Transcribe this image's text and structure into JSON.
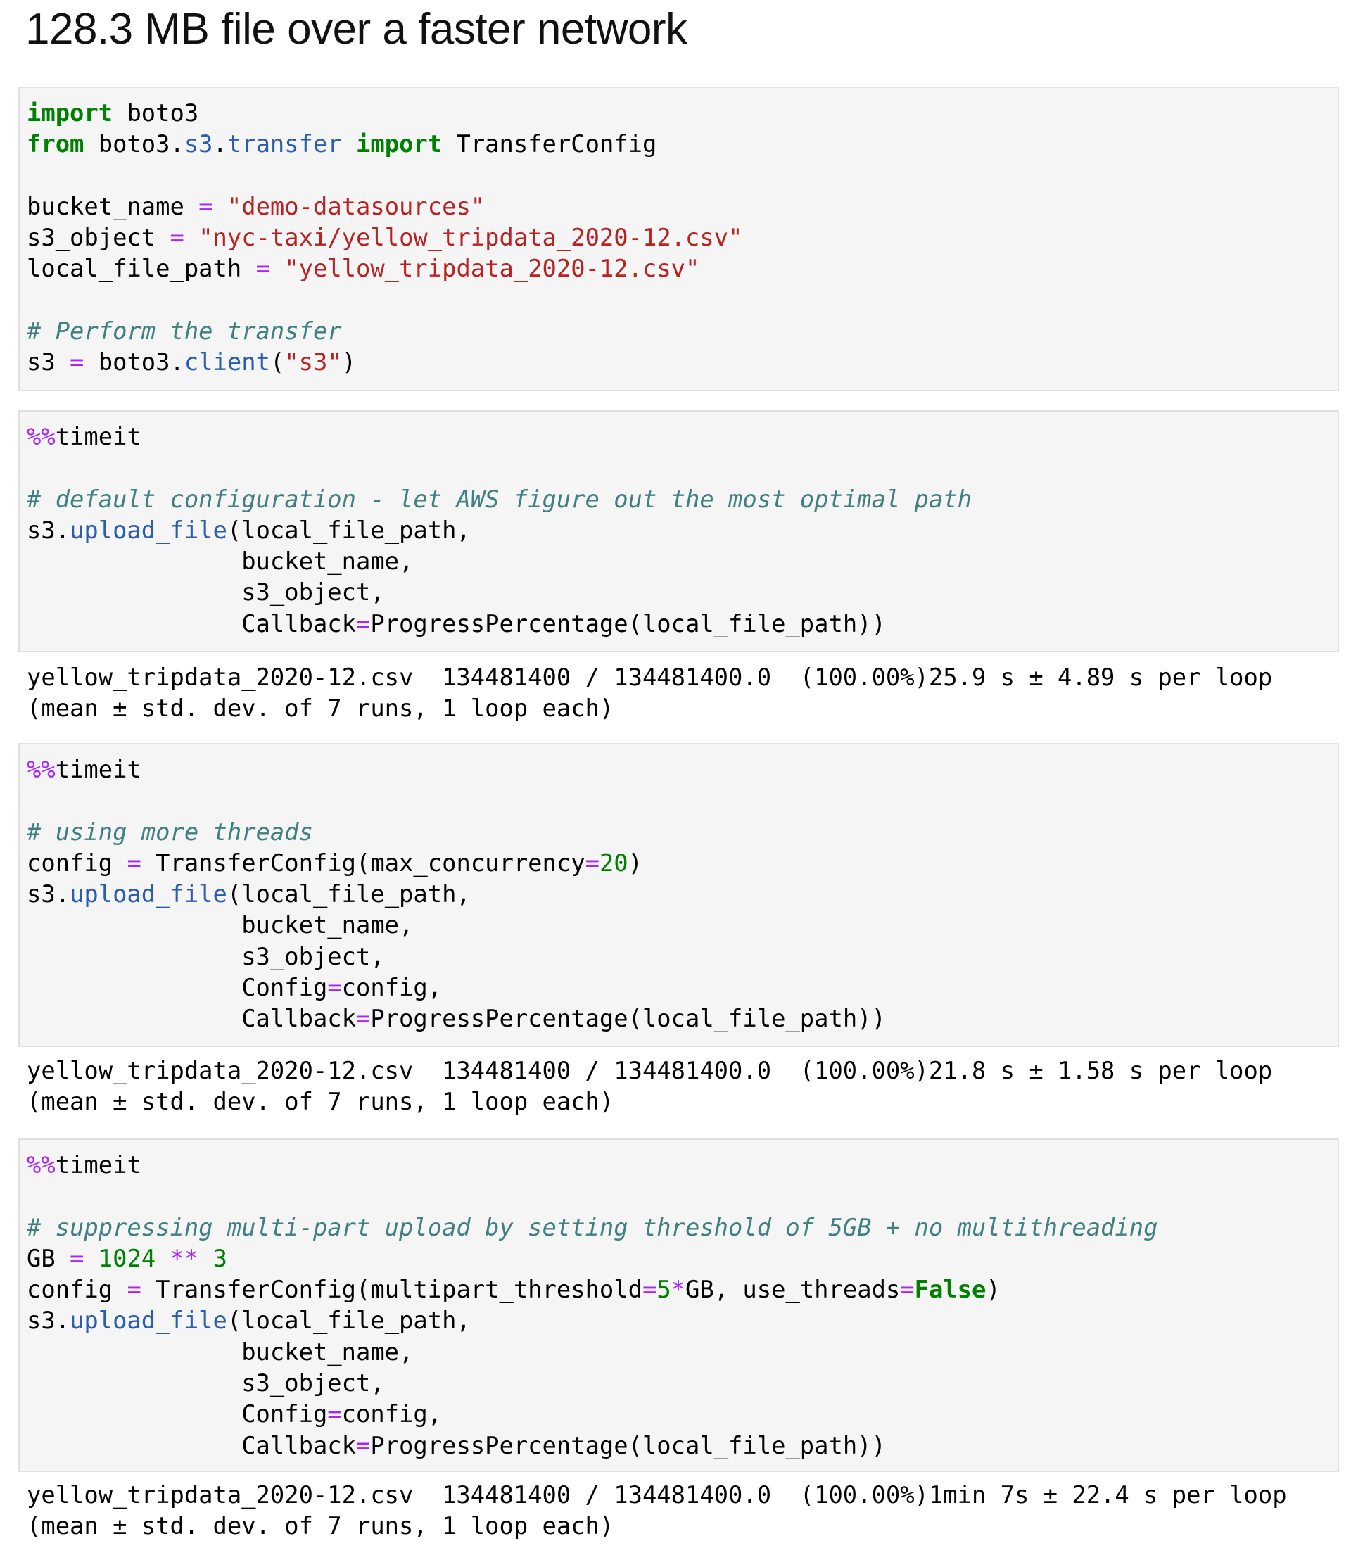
{
  "page": {
    "title": "128.3 MB file over a faster network"
  },
  "theme": {
    "keyword": "#008000",
    "operator": "#aa22ff",
    "number": "#008000",
    "string": "#ba2121",
    "comment": "#408080",
    "property": "#2a5db0",
    "cell_background": "#f5f5f5",
    "cell_border": "#e0e0e0"
  },
  "cells": [
    {
      "prompt": ":",
      "code": [
        [
          [
            "kw",
            "import"
          ],
          [
            "plain",
            " boto3"
          ]
        ],
        [
          [
            "kw",
            "from"
          ],
          [
            "plain",
            " boto3."
          ],
          [
            "prop",
            "s3"
          ],
          [
            "plain",
            "."
          ],
          [
            "prop",
            "transfer"
          ],
          [
            "plain",
            " "
          ],
          [
            "kw",
            "import"
          ],
          [
            "plain",
            " TransferConfig"
          ]
        ],
        [],
        [
          [
            "plain",
            "bucket_name "
          ],
          [
            "op",
            "="
          ],
          [
            "plain",
            " "
          ],
          [
            "str",
            "\"demo-datasources\""
          ]
        ],
        [
          [
            "plain",
            "s3_object "
          ],
          [
            "op",
            "="
          ],
          [
            "plain",
            " "
          ],
          [
            "str",
            "\"nyc-taxi/yellow_tripdata_2020-12.csv\""
          ]
        ],
        [
          [
            "plain",
            "local_file_path "
          ],
          [
            "op",
            "="
          ],
          [
            "plain",
            " "
          ],
          [
            "str",
            "\"yellow_tripdata_2020-12.csv\""
          ]
        ],
        [],
        [
          [
            "cm",
            "# Perform the transfer"
          ]
        ],
        [
          [
            "plain",
            "s3 "
          ],
          [
            "op",
            "="
          ],
          [
            "plain",
            " boto3."
          ],
          [
            "prop",
            "client"
          ],
          [
            "plain",
            "("
          ],
          [
            "str",
            "\"s3\""
          ],
          [
            "plain",
            ")"
          ]
        ]
      ],
      "output": []
    },
    {
      "prompt": ":",
      "code": [
        [
          [
            "magic",
            "%%"
          ],
          [
            "plain",
            "timeit"
          ]
        ],
        [],
        [
          [
            "cm",
            "# default configuration - let AWS figure out the most optimal path"
          ]
        ],
        [
          [
            "plain",
            "s3."
          ],
          [
            "prop",
            "upload_file"
          ],
          [
            "plain",
            "(local_file_path,"
          ]
        ],
        [
          [
            "plain",
            "               bucket_name,"
          ]
        ],
        [
          [
            "plain",
            "               s3_object,"
          ]
        ],
        [
          [
            "plain",
            "               Callback"
          ],
          [
            "op",
            "="
          ],
          [
            "plain",
            "ProgressPercentage(local_file_path))"
          ]
        ]
      ],
      "output": [
        "yellow_tripdata_2020-12.csv  134481400 / 134481400.0  (100.00%)25.9 s ± 4.89 s per loop",
        "(mean ± std. dev. of 7 runs, 1 loop each)"
      ]
    },
    {
      "prompt": ":",
      "code": [
        [
          [
            "magic",
            "%%"
          ],
          [
            "plain",
            "timeit"
          ]
        ],
        [],
        [
          [
            "cm",
            "# using more threads"
          ]
        ],
        [
          [
            "plain",
            "config "
          ],
          [
            "op",
            "="
          ],
          [
            "plain",
            " TransferConfig(max_concurrency"
          ],
          [
            "op",
            "="
          ],
          [
            "num",
            "20"
          ],
          [
            "plain",
            ")"
          ]
        ],
        [
          [
            "plain",
            "s3."
          ],
          [
            "prop",
            "upload_file"
          ],
          [
            "plain",
            "(local_file_path,"
          ]
        ],
        [
          [
            "plain",
            "               bucket_name,"
          ]
        ],
        [
          [
            "plain",
            "               s3_object,"
          ]
        ],
        [
          [
            "plain",
            "               Config"
          ],
          [
            "op",
            "="
          ],
          [
            "plain",
            "config,"
          ]
        ],
        [
          [
            "plain",
            "               Callback"
          ],
          [
            "op",
            "="
          ],
          [
            "plain",
            "ProgressPercentage(local_file_path))"
          ]
        ]
      ],
      "output": [
        "yellow_tripdata_2020-12.csv  134481400 / 134481400.0  (100.00%)21.8 s ± 1.58 s per loop",
        "(mean ± std. dev. of 7 runs, 1 loop each)"
      ]
    },
    {
      "prompt": ":",
      "code": [
        [
          [
            "magic",
            "%%"
          ],
          [
            "plain",
            "timeit"
          ]
        ],
        [],
        [
          [
            "cm",
            "# suppressing multi-part upload by setting threshold of 5GB + no multithreading"
          ]
        ],
        [
          [
            "plain",
            "GB "
          ],
          [
            "op",
            "="
          ],
          [
            "plain",
            " "
          ],
          [
            "num",
            "1024"
          ],
          [
            "plain",
            " "
          ],
          [
            "op",
            "**"
          ],
          [
            "plain",
            " "
          ],
          [
            "num",
            "3"
          ]
        ],
        [
          [
            "plain",
            "config "
          ],
          [
            "op",
            "="
          ],
          [
            "plain",
            " TransferConfig(multipart_threshold"
          ],
          [
            "op",
            "="
          ],
          [
            "num",
            "5"
          ],
          [
            "op",
            "*"
          ],
          [
            "plain",
            "GB, use_threads"
          ],
          [
            "op",
            "="
          ],
          [
            "kw",
            "False"
          ],
          [
            "plain",
            ")"
          ]
        ],
        [
          [
            "plain",
            "s3."
          ],
          [
            "prop",
            "upload_file"
          ],
          [
            "plain",
            "(local_file_path,"
          ]
        ],
        [
          [
            "plain",
            "               bucket_name,"
          ]
        ],
        [
          [
            "plain",
            "               s3_object,"
          ]
        ],
        [
          [
            "plain",
            "               Config"
          ],
          [
            "op",
            "="
          ],
          [
            "plain",
            "config,"
          ]
        ],
        [
          [
            "plain",
            "               Callback"
          ],
          [
            "op",
            "="
          ],
          [
            "plain",
            "ProgressPercentage(local_file_path))"
          ]
        ]
      ],
      "output": [
        "yellow_tripdata_2020-12.csv  134481400 / 134481400.0  (100.00%)1min 7s ± 22.4 s per loop",
        "(mean ± std. dev. of 7 runs, 1 loop each)"
      ]
    }
  ]
}
